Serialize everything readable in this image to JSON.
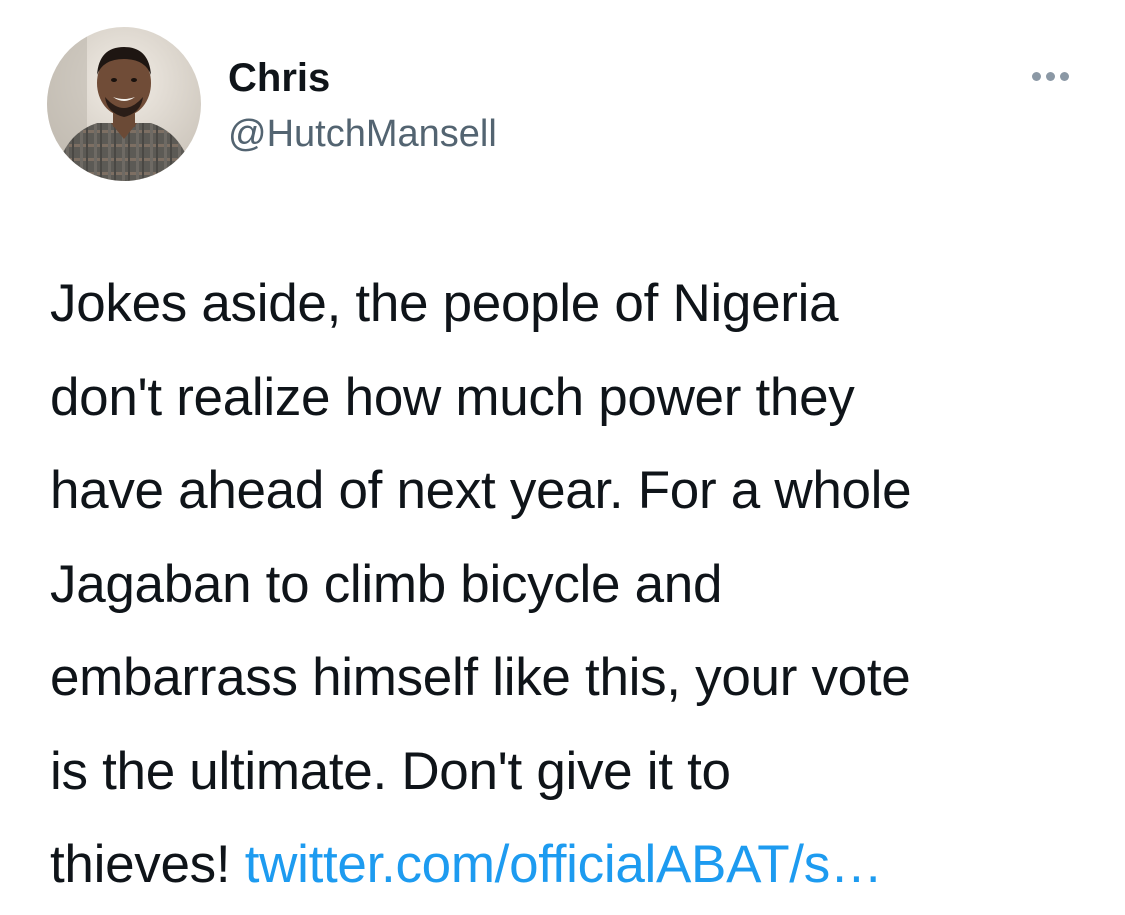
{
  "tweet": {
    "author": {
      "name": "Chris",
      "handle": "@HutchMansell"
    },
    "more_icon": "more-horizontal-icon",
    "text_lines": [
      "Jokes aside, the people of Nigeria",
      "don't realize how much power they",
      "have ahead of next year. For a whole",
      "Jagaban to climb bicycle and",
      "embarrass himself like this, your vote",
      "is the ultimate. Don't give it to",
      "thieves!"
    ],
    "link_text": "twitter.com/officialABAT/s…"
  },
  "colors": {
    "text": "#0f1419",
    "secondary_text": "#536471",
    "link": "#1d9bf0",
    "background": "#ffffff"
  }
}
